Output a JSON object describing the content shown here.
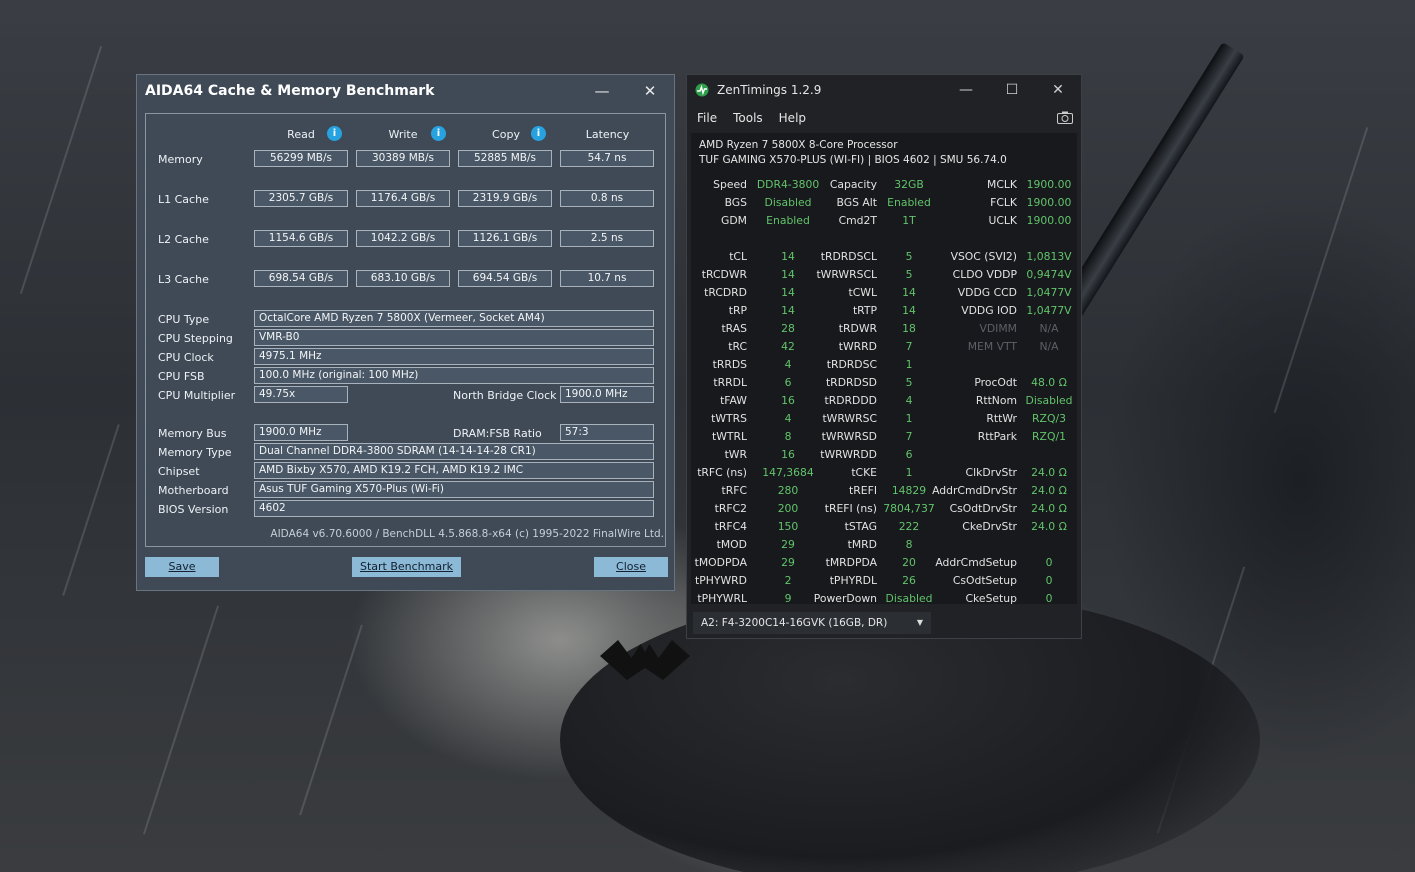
{
  "aida": {
    "title": "AIDA64 Cache & Memory Benchmark",
    "minimize": "—",
    "close_x": "✕",
    "headers": {
      "read": "Read",
      "write": "Write",
      "copy": "Copy",
      "latency": "Latency"
    },
    "info_glyph": "i",
    "rows": [
      {
        "label": "Memory",
        "read": "56299 MB/s",
        "write": "30389 MB/s",
        "copy": "52885 MB/s",
        "latency": "54.7 ns"
      },
      {
        "label": "L1 Cache",
        "read": "2305.7 GB/s",
        "write": "1176.4 GB/s",
        "copy": "2319.9 GB/s",
        "latency": "0.8 ns"
      },
      {
        "label": "L2 Cache",
        "read": "1154.6 GB/s",
        "write": "1042.2 GB/s",
        "copy": "1126.1 GB/s",
        "latency": "2.5 ns"
      },
      {
        "label": "L3 Cache",
        "read": "698.54 GB/s",
        "write": "683.10 GB/s",
        "copy": "694.54 GB/s",
        "latency": "10.7 ns"
      }
    ],
    "cpu_type_label": "CPU Type",
    "cpu_type": "OctalCore AMD Ryzen 7 5800X  (Vermeer, Socket AM4)",
    "cpu_stepping_label": "CPU Stepping",
    "cpu_stepping": "VMR-B0",
    "cpu_clock_label": "CPU Clock",
    "cpu_clock": "4975.1 MHz",
    "cpu_fsb_label": "CPU FSB",
    "cpu_fsb": "100.0 MHz  (original: 100 MHz)",
    "cpu_mult_label": "CPU Multiplier",
    "cpu_mult": "49.75x",
    "nb_clock_label": "North Bridge Clock",
    "nb_clock": "1900.0 MHz",
    "mem_bus_label": "Memory Bus",
    "mem_bus": "1900.0 MHz",
    "dram_fsb_label": "DRAM:FSB Ratio",
    "dram_fsb": "57:3",
    "mem_type_label": "Memory Type",
    "mem_type": "Dual Channel DDR4-3800 SDRAM  (14-14-14-28 CR1)",
    "chipset_label": "Chipset",
    "chipset": "AMD Bixby X570, AMD K19.2 FCH, AMD K19.2 IMC",
    "mobo_label": "Motherboard",
    "mobo": "Asus TUF Gaming X570-Plus (Wi-Fi)",
    "bios_label": "BIOS Version",
    "bios": "4602",
    "footer": "AIDA64 v6.70.6000 / BenchDLL 4.5.868.8-x64  (c) 1995-2022 FinalWire Ltd.",
    "save": "Save",
    "start": "Start Benchmark",
    "close": "Close"
  },
  "zen": {
    "title": "ZenTimings 1.2.9",
    "minimize": "—",
    "maximize": "☐",
    "close_x": "✕",
    "menu": [
      "File",
      "Tools",
      "Help"
    ],
    "camera_icon": "📷",
    "cpu_name": "AMD Ryzen 7 5800X 8-Core Processor",
    "board": "TUF GAMING X570-PLUS (WI-FI) | BIOS 4602 | SMU 56.74.0",
    "col1": [
      [
        "Speed",
        "DDR4-3800"
      ],
      [
        "BGS",
        "Disabled"
      ],
      [
        "GDM",
        "Enabled"
      ],
      [
        "",
        ""
      ],
      [
        "tCL",
        "14"
      ],
      [
        "tRCDWR",
        "14"
      ],
      [
        "tRCDRD",
        "14"
      ],
      [
        "tRP",
        "14"
      ],
      [
        "tRAS",
        "28"
      ],
      [
        "tRC",
        "42"
      ],
      [
        "tRRDS",
        "4"
      ],
      [
        "tRRDL",
        "6"
      ],
      [
        "tFAW",
        "16"
      ],
      [
        "tWTRS",
        "4"
      ],
      [
        "tWTRL",
        "8"
      ],
      [
        "tWR",
        "16"
      ],
      [
        "tRFC (ns)",
        "147,3684"
      ],
      [
        "tRFC",
        "280"
      ],
      [
        "tRFC2",
        "200"
      ],
      [
        "tRFC4",
        "150"
      ],
      [
        "tMOD",
        "29"
      ],
      [
        "tMODPDA",
        "29"
      ],
      [
        "tPHYWRD",
        "2"
      ],
      [
        "tPHYWRL",
        "9"
      ]
    ],
    "col2": [
      [
        "Capacity",
        "32GB"
      ],
      [
        "BGS Alt",
        "Enabled"
      ],
      [
        "Cmd2T",
        "1T"
      ],
      [
        "",
        ""
      ],
      [
        "tRDRDSCL",
        "5"
      ],
      [
        "tWRWRSCL",
        "5"
      ],
      [
        "tCWL",
        "14"
      ],
      [
        "tRTP",
        "14"
      ],
      [
        "tRDWR",
        "18"
      ],
      [
        "tWRRD",
        "7"
      ],
      [
        "tRDRDSC",
        "1"
      ],
      [
        "tRDRDSD",
        "5"
      ],
      [
        "tRDRDDD",
        "4"
      ],
      [
        "tWRWRSC",
        "1"
      ],
      [
        "tWRWRSD",
        "7"
      ],
      [
        "tWRWRDD",
        "6"
      ],
      [
        "tCKE",
        "1"
      ],
      [
        "tREFI",
        "14829"
      ],
      [
        "tREFI (ns)",
        "7804,737"
      ],
      [
        "tSTAG",
        "222"
      ],
      [
        "tMRD",
        "8"
      ],
      [
        "tMRDPDA",
        "20"
      ],
      [
        "tPHYRDL",
        "26"
      ],
      [
        "PowerDown",
        "Disabled"
      ]
    ],
    "col3": [
      [
        "MCLK",
        "1900.00"
      ],
      [
        "FCLK",
        "1900.00"
      ],
      [
        "UCLK",
        "1900.00"
      ],
      [
        "",
        ""
      ],
      [
        "VSOC (SVI2)",
        "1,0813V"
      ],
      [
        "CLDO VDDP",
        "0,9474V"
      ],
      [
        "VDDG CCD",
        "1,0477V"
      ],
      [
        "VDDG IOD",
        "1,0477V"
      ],
      [
        "VDIMM",
        "N/A"
      ],
      [
        "MEM VTT",
        "N/A"
      ],
      [
        "",
        ""
      ],
      [
        "ProcOdt",
        "48.0 Ω"
      ],
      [
        "RttNom",
        "Disabled"
      ],
      [
        "RttWr",
        "RZQ/3"
      ],
      [
        "RttPark",
        "RZQ/1"
      ],
      [
        "",
        ""
      ],
      [
        "ClkDrvStr",
        "24.0 Ω"
      ],
      [
        "AddrCmdDrvStr",
        "24.0 Ω"
      ],
      [
        "CsOdtDrvStr",
        "24.0 Ω"
      ],
      [
        "CkeDrvStr",
        "24.0 Ω"
      ],
      [
        "",
        ""
      ],
      [
        "AddrCmdSetup",
        "0"
      ],
      [
        "CsOdtSetup",
        "0"
      ],
      [
        "CkeSetup",
        "0"
      ]
    ],
    "dropdown": "A2: F4-3200C14-16GVK (16GB, DR)",
    "dropdown_arrow": "▼",
    "accent": "#62c46b"
  }
}
